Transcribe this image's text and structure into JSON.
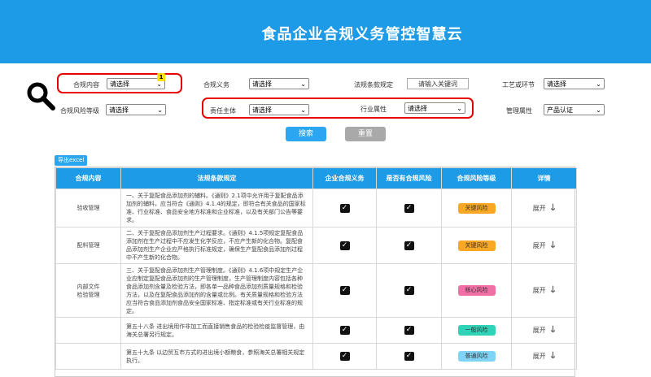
{
  "header": {
    "title": "食品企业合规义务管控智慧云"
  },
  "filters": {
    "compliance_content": {
      "label": "合规内容",
      "value": "请选择"
    },
    "compliance_duty": {
      "label": "合规义务",
      "value": "请选择"
    },
    "law_rule": {
      "label": "法规条款规定",
      "placeholder": "请输入关键词"
    },
    "process_step": {
      "label": "工艺或环节",
      "value": "请选择"
    },
    "risk_level": {
      "label": "合规风险等级",
      "value": "请选择"
    },
    "responsible": {
      "label": "责任主体",
      "value": "请选择"
    },
    "industry": {
      "label": "行业属性",
      "value": "请选择"
    },
    "mgmt_attr": {
      "label": "管理属性",
      "value": "产品认证"
    },
    "badge": "1"
  },
  "buttons": {
    "search": "搜索",
    "reset": "重置",
    "export": "导出excel"
  },
  "table": {
    "headers": [
      "合规内容",
      "法规条款规定",
      "企业合规义务",
      "是否有合规风险",
      "合规风险等级",
      "详情"
    ],
    "expand_label": "展开",
    "rows": [
      {
        "content": "验收管理",
        "rule": "一、关于复配食品添加剂的辅料。《通则》2.1项中允许用于复配食品添加剂的辅料，应当符合《通则》4.1.4的规定，即符合有关食品的国家标准、行业标准、食品安全地方标准和企业标准，以及有关部门公告等要求。",
        "risk": "关键风险",
        "risk_color": "#f9a825"
      },
      {
        "content": "配料管理",
        "rule": "二、关于复配食品添加剂生产过程要求。《通则》4.1.5项规定复配食品添加剂在生产过程中不应发生化学反应，不应产生新的化合物。复配食品添加剂生产企业应严格执行标准规定，确保生产复配食品添加剂过程中不产生新的化合物。",
        "risk": "关键风险",
        "risk_color": "#f9a825"
      },
      {
        "content": "内部文件\n检验管理",
        "rule": "三、关于复配食品添加剂生产管理制度。《通则》4.1.6项中规定生产企业应制定复配食品添加剂的生产管理制度，生产管理制度内容包括各种食品添加剂含量及检验方法，即各单一品种食品添加剂质量规格和检验方法，以及在复配食品添加剂的含量或比例。有关质量规格和检验方法应当符合食品添加剂食品安全国家标准、指定标准或有关行业标准的规定。",
        "risk": "核心风险",
        "risk_color": "#f06fa5"
      },
      {
        "content": "",
        "rule": "第五十八条 进出境用作非加工而直接销售食品的检验检疫监督管理，由海关总署另行规定。",
        "risk": "一般风险",
        "risk_color": "#2fd3b8"
      },
      {
        "content": "",
        "rule": "第五十九条 以边贸互市方式的进出境小额粮食，参照海关总署相关规定执行。",
        "risk": "普通风险",
        "risk_color": "#7fd3f5"
      }
    ]
  },
  "colors": {
    "primary": "#1e9be6",
    "highlight": "#e60000"
  }
}
